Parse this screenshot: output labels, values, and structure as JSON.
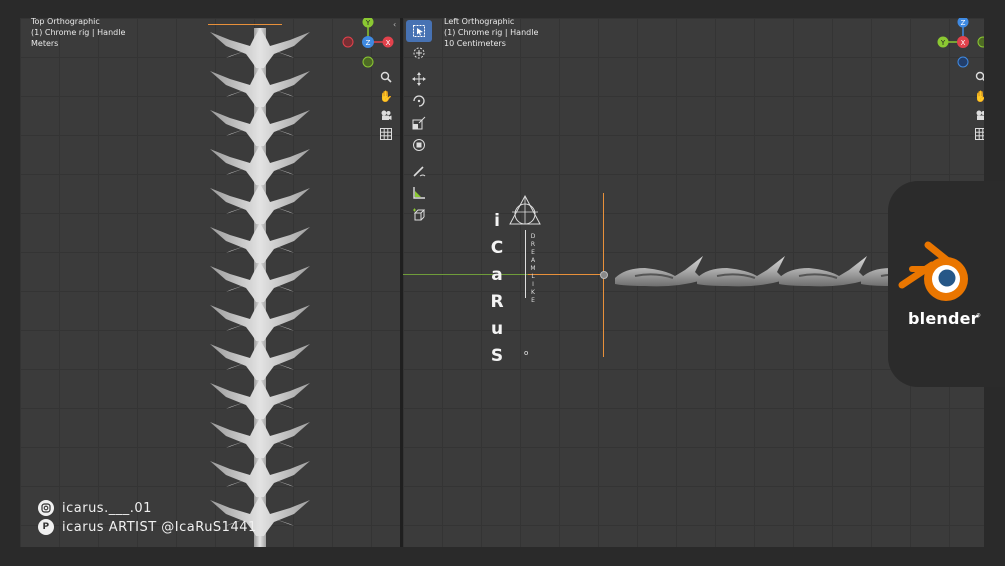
{
  "viewports": {
    "left": {
      "view_name": "Top Orthographic",
      "object_info": "(1) Chrome rig | Handle",
      "units": "Meters"
    },
    "right": {
      "view_name": "Left Orthographic",
      "object_info": "(1) Chrome rig | Handle",
      "units": "10 Centimeters"
    }
  },
  "gizmo_left": {
    "y": "Y",
    "z": "Z",
    "x": "X"
  },
  "gizmo_right": {
    "z": "Z",
    "y": "Y",
    "x": "X"
  },
  "branding": {
    "letters": [
      "i",
      "C",
      "a",
      "R",
      "u",
      "S"
    ],
    "dot": "o",
    "vertical_word": [
      "D",
      "R",
      "E",
      "A",
      "M",
      "L",
      "I",
      "K",
      "E"
    ],
    "logo_word": "blender"
  },
  "social": {
    "instagram": "icarus.___.01",
    "pinterest": "icarus ARTIST @IcaRuS1441"
  },
  "icons": {
    "zoom": "zoom-icon",
    "pan": "hand-icon",
    "camera": "camera-icon",
    "grid": "grid-icon",
    "select": "select-box-icon",
    "cursor": "cursor-icon",
    "move": "move-icon",
    "rotate": "rotate-icon",
    "scale": "scale-icon",
    "transform": "transform-icon",
    "annotate": "annotate-icon",
    "measure": "measure-icon",
    "add_cube": "add-cube-icon"
  },
  "colors": {
    "axis_x": "#e2424c",
    "axis_y": "#8bc832",
    "axis_z": "#3f8ae2",
    "origin_line": "#e8903a",
    "blender_orange": "#ea7600",
    "blender_blue": "#265787",
    "active_tool": "#4772b3"
  }
}
